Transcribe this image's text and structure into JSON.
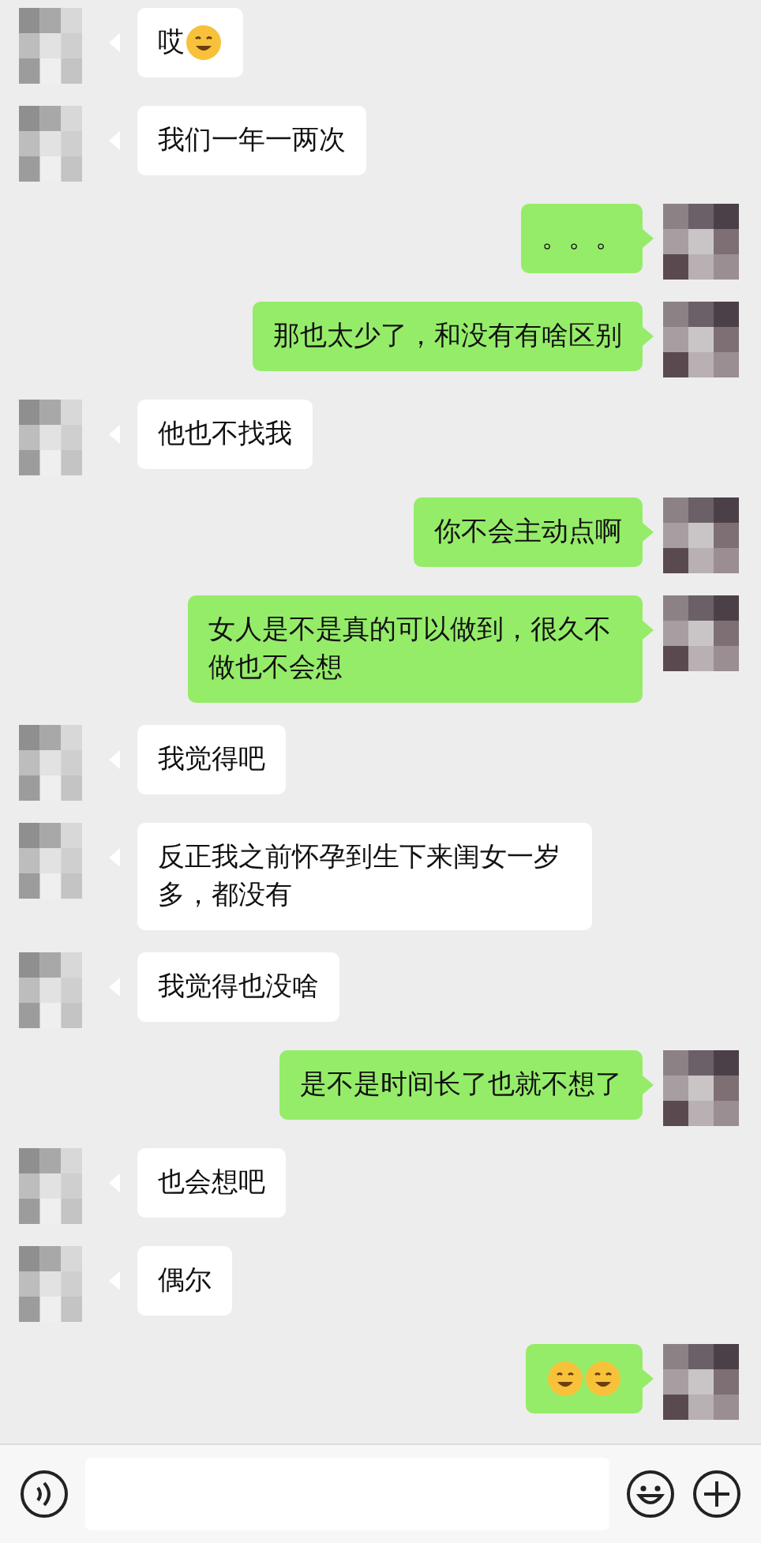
{
  "messages": [
    {
      "sent": false,
      "parts": [
        {
          "kind": "text",
          "text": "哎"
        },
        {
          "kind": "emoji"
        }
      ]
    },
    {
      "sent": false,
      "parts": [
        {
          "kind": "text",
          "text": "我们一年一两次"
        }
      ]
    },
    {
      "sent": true,
      "parts": [
        {
          "kind": "text",
          "text": "。。。"
        }
      ]
    },
    {
      "sent": true,
      "parts": [
        {
          "kind": "text",
          "text": "那也太少了，和没有有啥区别"
        }
      ]
    },
    {
      "sent": false,
      "parts": [
        {
          "kind": "text",
          "text": "他也不找我"
        }
      ]
    },
    {
      "sent": true,
      "parts": [
        {
          "kind": "text",
          "text": "你不会主动点啊"
        }
      ]
    },
    {
      "sent": true,
      "parts": [
        {
          "kind": "text",
          "text": "女人是不是真的可以做到，很久不做也不会想"
        }
      ]
    },
    {
      "sent": false,
      "parts": [
        {
          "kind": "text",
          "text": "我觉得吧"
        }
      ]
    },
    {
      "sent": false,
      "parts": [
        {
          "kind": "text",
          "text": "反正我之前怀孕到生下来闺女一岁多，都没有"
        }
      ]
    },
    {
      "sent": false,
      "parts": [
        {
          "kind": "text",
          "text": "我觉得也没啥"
        }
      ]
    },
    {
      "sent": true,
      "parts": [
        {
          "kind": "text",
          "text": "是不是时间长了也就不想了"
        }
      ]
    },
    {
      "sent": false,
      "parts": [
        {
          "kind": "text",
          "text": "也会想吧"
        }
      ]
    },
    {
      "sent": false,
      "parts": [
        {
          "kind": "text",
          "text": "偶尔"
        }
      ]
    },
    {
      "sent": true,
      "parts": [
        {
          "kind": "emoji"
        },
        {
          "kind": "emoji"
        }
      ]
    }
  ]
}
